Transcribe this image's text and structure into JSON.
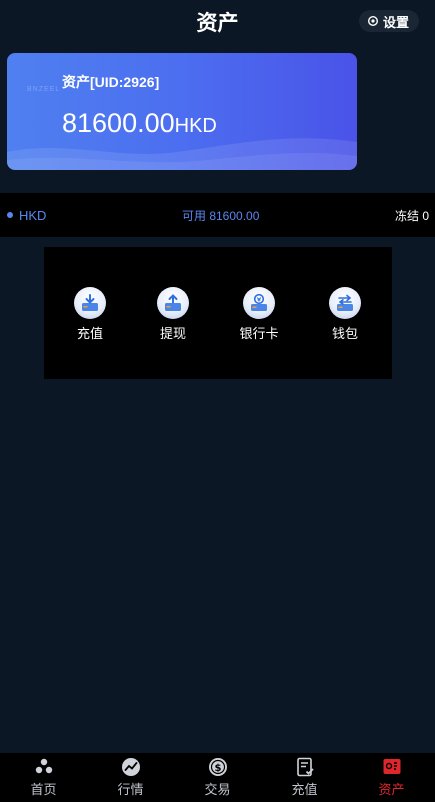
{
  "header": {
    "title": "资产",
    "settings_label": "设置"
  },
  "asset_card": {
    "label": "资产[UID:2926]",
    "amount": "81600.00",
    "currency": "HKD",
    "watermark": "BNZEEL"
  },
  "balance": {
    "currency": "HKD",
    "available": "可用 81600.00",
    "frozen": "冻结 0"
  },
  "actions": [
    {
      "label": "充值",
      "icon": "deposit-icon"
    },
    {
      "label": "提现",
      "icon": "withdraw-icon"
    },
    {
      "label": "银行卡",
      "icon": "bank-card-icon"
    },
    {
      "label": "钱包",
      "icon": "wallet-icon"
    }
  ],
  "tabbar": [
    {
      "label": "首页",
      "icon": "home-icon",
      "active": false
    },
    {
      "label": "行情",
      "icon": "market-icon",
      "active": false
    },
    {
      "label": "交易",
      "icon": "trade-icon",
      "active": false
    },
    {
      "label": "充值",
      "icon": "recharge-icon",
      "active": false
    },
    {
      "label": "资产",
      "icon": "assets-icon",
      "active": true
    }
  ],
  "colors": {
    "background": "#0b1724",
    "accent": "#5b86f0",
    "active_tab": "#e0262d"
  }
}
